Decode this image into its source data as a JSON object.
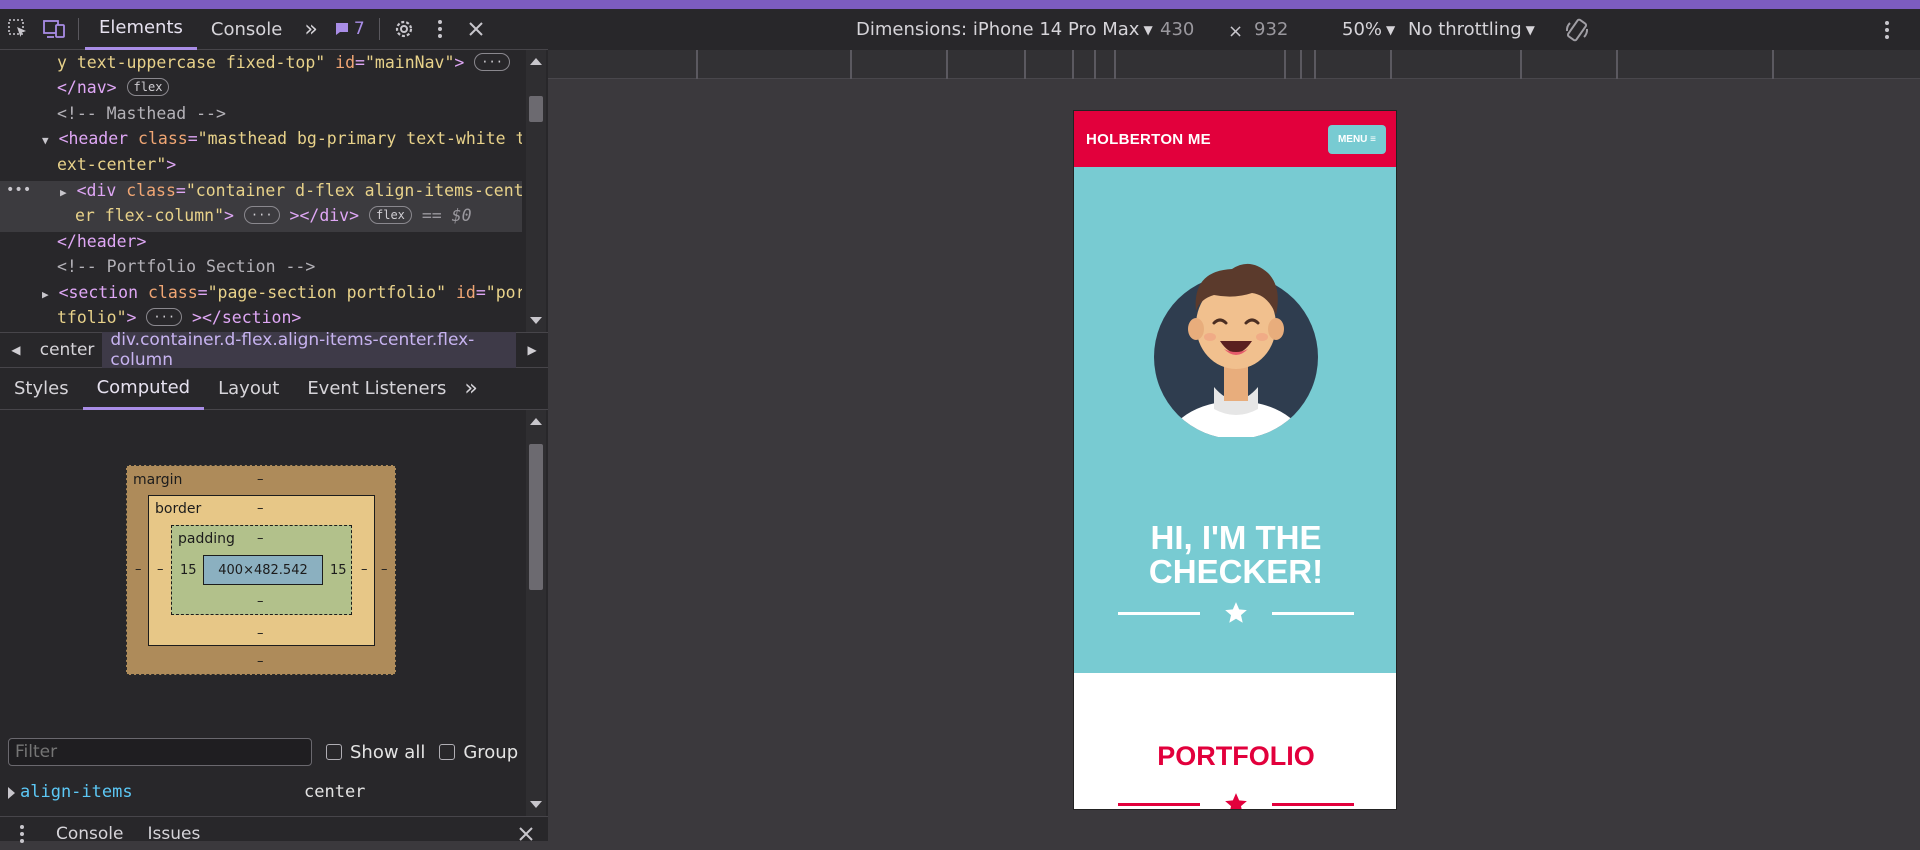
{
  "devtools": {
    "tabs": {
      "elements": "Elements",
      "console": "Console",
      "more": "»"
    },
    "issues_count": "7",
    "dom_lines": {
      "l1_text": "y text-uppercase fixed-top\"",
      "l1_attr": "id",
      "l1_val": "\"mainNav\"",
      "l2": "</nav>",
      "l2_pill": "flex",
      "l3": "<!-- Masthead -->",
      "l4_tag": "<header",
      "l4_attr": "class",
      "l4_val": "\"masthead bg-primary text-white t",
      "l5_val": "ext-center\"",
      "l5_tag": ">",
      "l6_tag": "<div",
      "l6_attr": "class",
      "l6_val": "\"container d-flex align-items-cent",
      "l7_val": "er flex-column\"",
      "l7_tag": "></div>",
      "l7_pill": "flex",
      "l7_eq": "== $0",
      "l8": "</header>",
      "l9": "<!-- Portfolio Section -->",
      "l10_tag": "<section",
      "l10_attr": "class",
      "l10_val": "\"page-section portfolio\"",
      "l10_attr2": "id",
      "l10_val2": "\"por",
      "l11_val": "tfolio\"",
      "l11_tag": "></section>"
    },
    "breadcrumb": {
      "prev": "center",
      "current": "div.container.d-flex.align-items-center.flex-column"
    },
    "sub_tabs": {
      "styles": "Styles",
      "computed": "Computed",
      "layout": "Layout",
      "listeners": "Event Listeners",
      "more": "»"
    },
    "box_model": {
      "margin_label": "margin",
      "border_label": "border",
      "padding_label": "padding",
      "content": "400×482.542",
      "dash": "–",
      "padding_left": "15",
      "padding_right": "15"
    },
    "filter": {
      "placeholder": "Filter",
      "show_all": "Show all",
      "group": "Group"
    },
    "computed": {
      "prop": "align-items",
      "value": "center"
    },
    "drawer": {
      "console": "Console",
      "issues": "Issues"
    }
  },
  "device_toolbar": {
    "dimensions": "Dimensions: iPhone 14 Pro Max",
    "width": "430",
    "times": "×",
    "height": "932",
    "zoom": "50%",
    "throttling": "No throttling"
  },
  "phone": {
    "brand": "HOLBERTON ME",
    "menu": "MENU ≡",
    "hero_line1": "HI, I'M THE",
    "hero_line2": "CHECKER!",
    "portfolio": "PORTFOLIO",
    "colors": {
      "primary": "#e2003c",
      "secondary": "#78cbd2",
      "white": "#ffffff"
    }
  }
}
